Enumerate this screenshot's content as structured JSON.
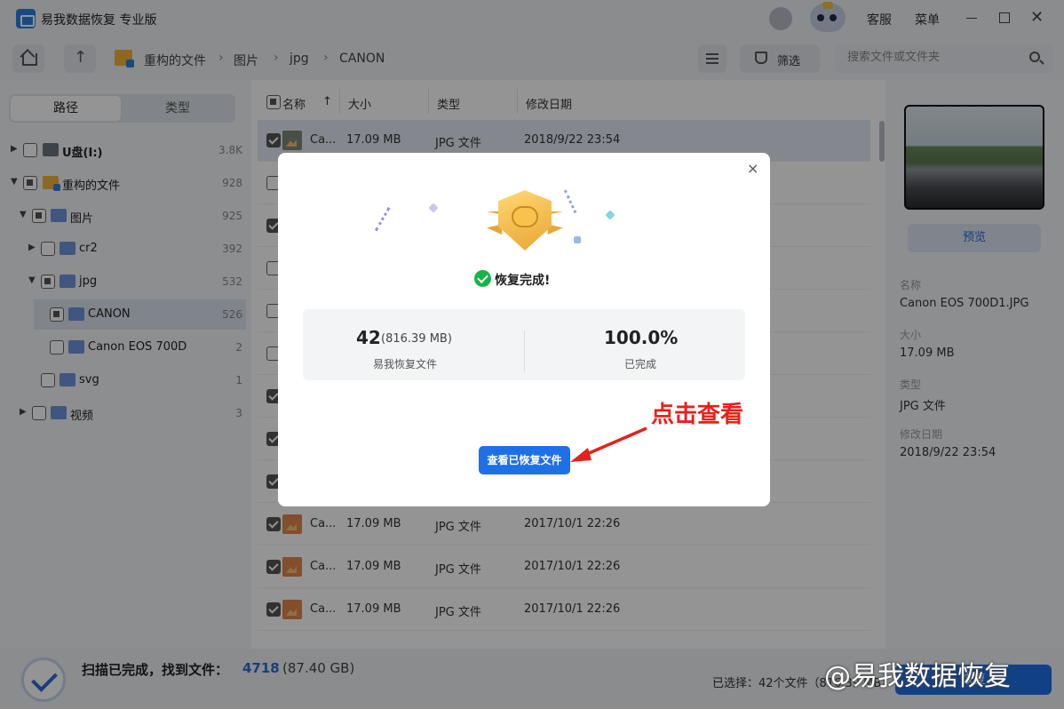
{
  "app": {
    "title": "易我数据恢复 专业版"
  },
  "titlebar": {
    "service": "客服",
    "menu": "菜单"
  },
  "toolbar": {
    "breadcrumb": [
      "重构的文件",
      "图片",
      "jpg",
      "CANON"
    ],
    "separator": "›",
    "filter_label": "筛选",
    "search_placeholder": "搜索文件或文件夹"
  },
  "left_panel": {
    "tabs": [
      "路径",
      "类型"
    ],
    "tree": [
      {
        "label": "U盘(I:)",
        "count": "3.8K"
      },
      {
        "label": "重构的文件",
        "count": "928"
      },
      {
        "label": "图片",
        "count": "925"
      },
      {
        "label": "cr2",
        "count": "392"
      },
      {
        "label": "jpg",
        "count": "532"
      },
      {
        "label": "CANON",
        "count": "526"
      },
      {
        "label": "Canon EOS 700D",
        "count": "2"
      },
      {
        "label": "svg",
        "count": "1"
      },
      {
        "label": "视频",
        "count": "3"
      }
    ]
  },
  "file_list": {
    "columns": [
      "名称",
      "大小",
      "类型",
      "修改日期"
    ],
    "sort_indicator": "↑",
    "rows": [
      {
        "name": "Ca...",
        "size": "17.09 MB",
        "type": "JPG 文件",
        "date": "2018/9/22 23:54"
      },
      {
        "name": "Ca...",
        "size": "17.09 MB",
        "type": "JPG 文件",
        "date": "2017/10/1 22:26"
      },
      {
        "name": "Ca...",
        "size": "17.09 MB",
        "type": "JPG 文件",
        "date": "2017/10/1 22:26"
      },
      {
        "name": "Ca...",
        "size": "17.09 MB",
        "type": "JPG 文件",
        "date": "2017/10/1 22:26"
      }
    ]
  },
  "right_panel": {
    "preview_button": "预览",
    "fields": [
      {
        "label": "名称",
        "value": "Canon EOS 700D1.JPG"
      },
      {
        "label": "大小",
        "value": "17.09 MB"
      },
      {
        "label": "类型",
        "value": "JPG 文件"
      },
      {
        "label": "修改日期",
        "value": "2018/9/22 23:54"
      }
    ]
  },
  "bottom": {
    "scan_text": "扫描已完成，找到文件：",
    "scan_count": "4718",
    "scan_size": "(87.40 GB)",
    "selected_text": "已选择：42个文件（816.39 MB）",
    "recover_button": "恢复"
  },
  "modal": {
    "close": "×",
    "success_text": "恢复完成!",
    "recovered_count": "42",
    "recovered_size": "(816.39 MB)",
    "recovered_label": "易我恢复文件",
    "percent": "100.0%",
    "percent_label": "已完成",
    "view_button": "查看已恢复文件"
  },
  "annotation": {
    "text": "点击查看",
    "color": "#e8201c"
  },
  "watermark": "@易我数据恢复",
  "colors": {
    "accent": "#1f6fe6",
    "success": "#17b347",
    "trophy": "#f2b33d"
  }
}
